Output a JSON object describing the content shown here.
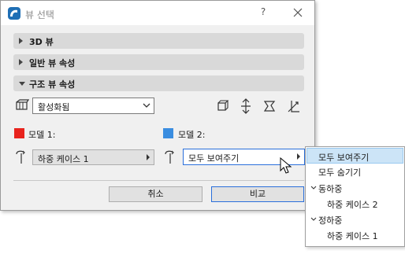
{
  "window": {
    "title": "뷰 선택",
    "help": "?"
  },
  "sections": [
    {
      "label": "3D 뷰",
      "expanded": false
    },
    {
      "label": "일반 뷰 속성",
      "expanded": false
    },
    {
      "label": "구조 뷰 속성",
      "expanded": true
    }
  ],
  "structure": {
    "view_select": {
      "value": "활성화됨"
    },
    "model1": {
      "label": "모델 1:",
      "color": "#e8231d",
      "value": "하중 케이스 1"
    },
    "model2": {
      "label": "모델 2:",
      "color": "#3a8de0",
      "value": "모두 보여주기"
    }
  },
  "buttons": {
    "cancel": "취소",
    "compare": "비교"
  },
  "menu": {
    "items": [
      {
        "label": "모두 보여주기",
        "selected": true
      },
      {
        "label": "모두 숨기기"
      },
      {
        "label": "동하중",
        "group": true
      },
      {
        "label": "하중 케이스 2",
        "indent": true
      },
      {
        "label": "정하중",
        "group": true
      },
      {
        "label": "하중 케이스 1",
        "indent": true
      }
    ]
  }
}
